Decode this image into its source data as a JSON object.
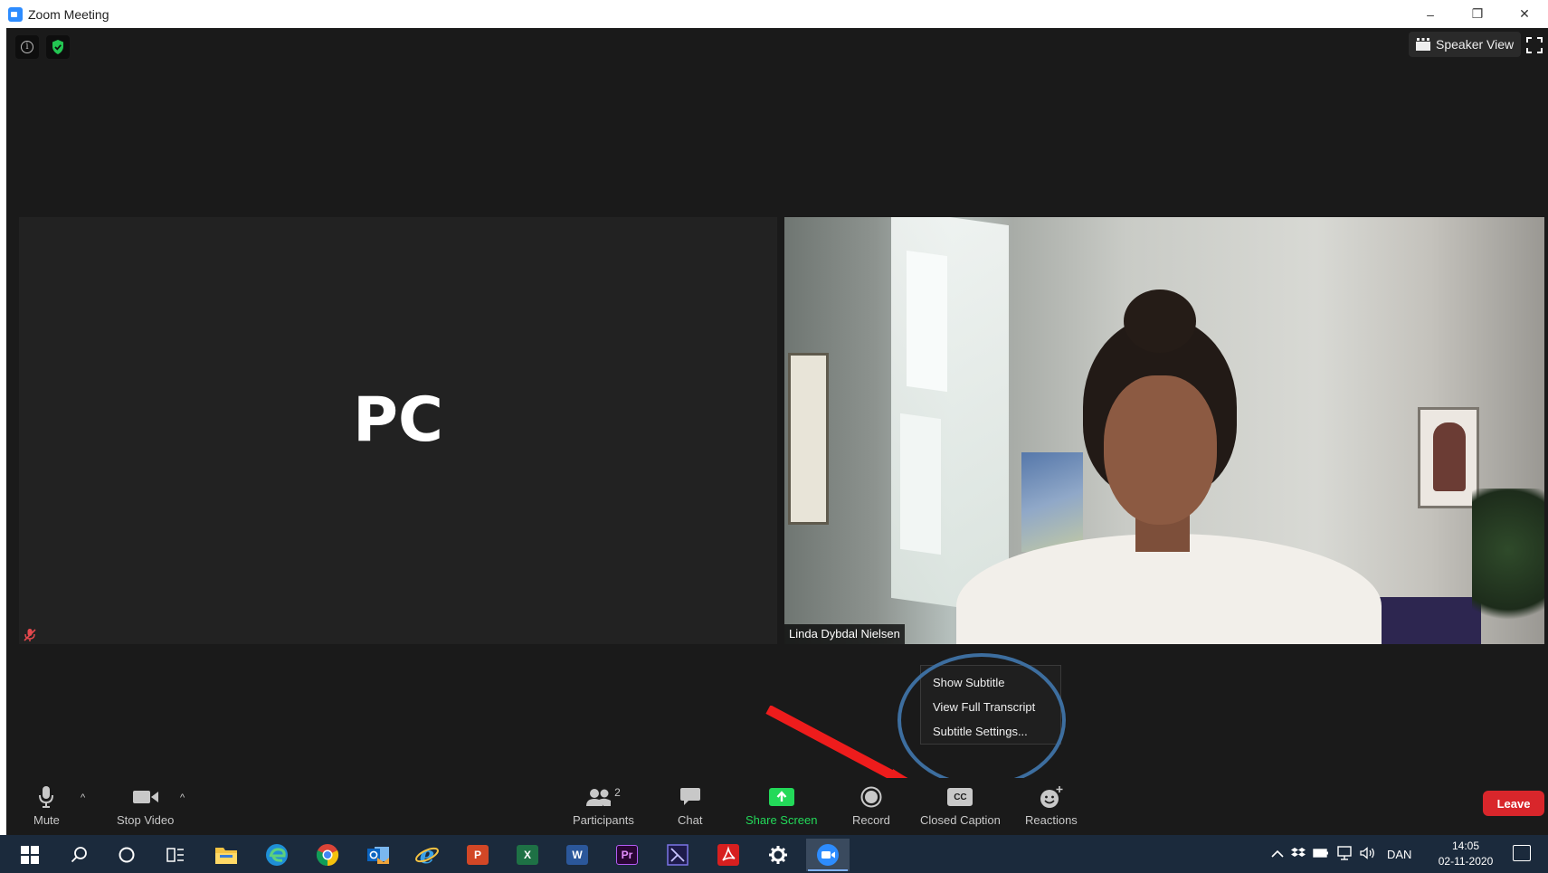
{
  "window": {
    "title": "Zoom Meeting",
    "minimize": "–",
    "restore": "❐",
    "close": "✕"
  },
  "meeting": {
    "speaker_view_label": "Speaker View",
    "left_tile": {
      "initials": "PC"
    },
    "right_tile": {
      "participant_name": "Linda Dybdal Nielsen"
    }
  },
  "caption_menu": {
    "items": [
      "Show Subtitle",
      "View Full Transcript",
      "Subtitle Settings..."
    ]
  },
  "toolbar": {
    "mute": "Mute",
    "stop_video": "Stop Video",
    "participants": "Participants",
    "participants_count": "2",
    "chat": "Chat",
    "share_screen": "Share Screen",
    "record": "Record",
    "closed_caption": "Closed Caption",
    "cc_glyph": "CC",
    "reactions": "Reactions",
    "leave": "Leave",
    "caret": "^"
  },
  "taskbar": {
    "apps": [
      {
        "name": "powerpoint",
        "glyph": "P"
      },
      {
        "name": "excel",
        "glyph": "X"
      },
      {
        "name": "word",
        "glyph": "W"
      },
      {
        "name": "premiere",
        "glyph": "Pr"
      }
    ],
    "language": "DAN",
    "time": "14:05",
    "date": "02-11-2020"
  },
  "colors": {
    "share_green": "#23d959",
    "leave_red": "#d9262b",
    "highlight_ring": "#3d6e9f",
    "arrow_red": "#ee1c1c"
  }
}
